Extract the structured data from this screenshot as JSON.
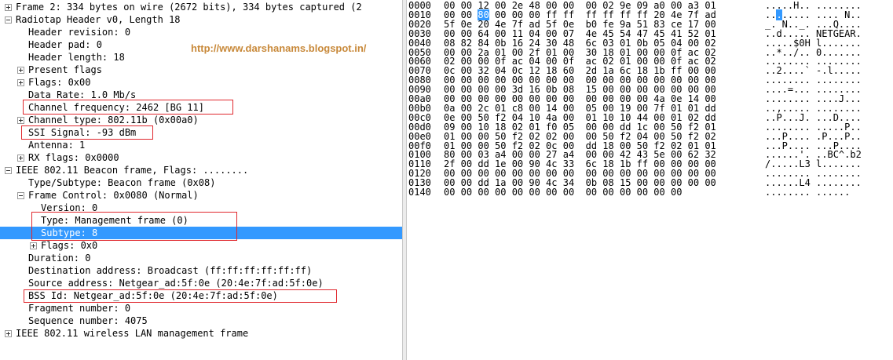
{
  "tree": [
    {
      "text": "Frame 2: 334 bytes on wire (2672 bits), 334 bytes captured (2",
      "indent": 0,
      "exp": "plus"
    },
    {
      "text": "Radiotap Header v0, Length 18",
      "indent": 0,
      "exp": "minus"
    },
    {
      "text": "Header revision: 0",
      "indent": 1,
      "exp": ""
    },
    {
      "text": "Header pad: 0",
      "indent": 1,
      "exp": ""
    },
    {
      "text": "Header length: 18",
      "indent": 1,
      "exp": ""
    },
    {
      "text": "Present flags",
      "indent": 1,
      "exp": "plus"
    },
    {
      "text": "Flags: 0x00",
      "indent": 1,
      "exp": "plus"
    },
    {
      "text": "Data Rate: 1.0 Mb/s",
      "indent": 1,
      "exp": ""
    },
    {
      "text": "Channel frequency: 2462 [BG 11]",
      "indent": 1,
      "exp": ""
    },
    {
      "text": "Channel type: 802.11b (0x00a0)",
      "indent": 1,
      "exp": "plus"
    },
    {
      "text": "SSI Signal: -93 dBm",
      "indent": 1,
      "exp": ""
    },
    {
      "text": "Antenna: 1",
      "indent": 1,
      "exp": ""
    },
    {
      "text": "RX flags: 0x0000",
      "indent": 1,
      "exp": "plus"
    },
    {
      "text": "IEEE 802.11 Beacon frame, Flags: ........",
      "indent": 0,
      "exp": "minus"
    },
    {
      "text": "Type/Subtype: Beacon frame (0x08)",
      "indent": 1,
      "exp": ""
    },
    {
      "text": "Frame Control: 0x0080 (Normal)",
      "indent": 1,
      "exp": "minus"
    },
    {
      "text": "Version: 0",
      "indent": 2,
      "exp": ""
    },
    {
      "text": "Type: Management frame (0)",
      "indent": 2,
      "exp": ""
    },
    {
      "text": "Subtype: 8",
      "indent": 2,
      "exp": "",
      "selected": true
    },
    {
      "text": "Flags: 0x0",
      "indent": 2,
      "exp": "plus"
    },
    {
      "text": "Duration: 0",
      "indent": 1,
      "exp": ""
    },
    {
      "text": "Destination address: Broadcast (ff:ff:ff:ff:ff:ff)",
      "indent": 1,
      "exp": ""
    },
    {
      "text": "Source address: Netgear_ad:5f:0e (20:4e:7f:ad:5f:0e)",
      "indent": 1,
      "exp": ""
    },
    {
      "text": "BSS Id: Netgear_ad:5f:0e (20:4e:7f:ad:5f:0e)",
      "indent": 1,
      "exp": ""
    },
    {
      "text": "Fragment number: 0",
      "indent": 1,
      "exp": ""
    },
    {
      "text": "Sequence number: 4075",
      "indent": 1,
      "exp": ""
    },
    {
      "text": "IEEE 802.11 wireless LAN management frame",
      "indent": 0,
      "exp": "plus"
    }
  ],
  "watermark": "http://www.darshanams.blogspot.in/",
  "hex": [
    {
      "off": "0000",
      "bytes": "00 00 12 00 2e 48 00 00  00 02 9e 09 a0 00 a3 01",
      "ascii": ".....H.. ........"
    },
    {
      "off": "0010",
      "bytes": "00 00 80 00 00 00 ff ff  ff ff ff ff 20 4e 7f ad",
      "ascii": "........ .... N..",
      "sel_byte": 2
    },
    {
      "off": "0020",
      "bytes": "5f 0e 20 4e 7f ad 5f 0e  b0 fe 9a 51 83 ce 17 00",
      "ascii": "_. N.._. ...Q...."
    },
    {
      "off": "0030",
      "bytes": "00 00 64 00 11 04 00 07  4e 45 54 47 45 41 52 01",
      "ascii": "..d..... NETGEAR."
    },
    {
      "off": "0040",
      "bytes": "08 82 84 0b 16 24 30 48  6c 03 01 0b 05 04 00 02",
      "ascii": ".....$0H l......."
    },
    {
      "off": "0050",
      "bytes": "00 00 2a 01 00 2f 01 00  30 18 01 00 00 0f ac 02",
      "ascii": "..*../.. 0......."
    },
    {
      "off": "0060",
      "bytes": "02 00 00 0f ac 04 00 0f  ac 02 01 00 00 0f ac 02",
      "ascii": "........ ........"
    },
    {
      "off": "0070",
      "bytes": "0c 00 32 04 0c 12 18 60  2d 1a 6c 18 1b ff 00 00",
      "ascii": "..2....` -.l....."
    },
    {
      "off": "0080",
      "bytes": "00 00 00 00 00 00 00 00  00 00 00 00 00 00 00 00",
      "ascii": "........ ........"
    },
    {
      "off": "0090",
      "bytes": "00 00 00 00 3d 16 0b 08  15 00 00 00 00 00 00 00",
      "ascii": "....=... ........"
    },
    {
      "off": "00a0",
      "bytes": "00 00 00 00 00 00 00 00  00 00 00 00 4a 0e 14 00",
      "ascii": "........ ....J..."
    },
    {
      "off": "00b0",
      "bytes": "0a 00 2c 01 c8 00 14 00  05 00 19 00 7f 01 01 dd",
      "ascii": "..,..... ........"
    },
    {
      "off": "00c0",
      "bytes": "0e 00 50 f2 04 10 4a 00  01 10 10 44 00 01 02 dd",
      "ascii": "..P...J. ...D...."
    },
    {
      "off": "00d0",
      "bytes": "09 00 10 18 02 01 f0 05  00 00 dd 1c 00 50 f2 01",
      "ascii": "........ .....P.."
    },
    {
      "off": "00e0",
      "bytes": "01 00 00 50 f2 02 02 00  00 50 f2 04 00 50 f2 02",
      "ascii": "...P.... .P...P.."
    },
    {
      "off": "00f0",
      "bytes": "01 00 00 50 f2 02 0c 00  dd 18 00 50 f2 02 01 01",
      "ascii": "...P.... ...P...."
    },
    {
      "off": "0100",
      "bytes": "80 00 03 a4 00 00 27 a4  00 00 42 43 5e 00 62 32",
      "ascii": "......'. ..BC^.b2"
    },
    {
      "off": "0110",
      "bytes": "2f 00 dd 1e 00 90 4c 33  6c 18 1b ff 00 00 00 00",
      "ascii": "/.....L3 l......."
    },
    {
      "off": "0120",
      "bytes": "00 00 00 00 00 00 00 00  00 00 00 00 00 00 00 00",
      "ascii": "........ ........"
    },
    {
      "off": "0130",
      "bytes": "00 00 dd 1a 00 90 4c 34  0b 08 15 00 00 00 00 00",
      "ascii": "......L4 ........"
    },
    {
      "off": "0140",
      "bytes": "00 00 00 00 00 00 00 00  00 00 00 00 00 00",
      "ascii": "........ ......"
    }
  ],
  "colors": {
    "selection": "#3399ff",
    "highlight_box": "#e0282e",
    "watermark": "#c8893a"
  }
}
